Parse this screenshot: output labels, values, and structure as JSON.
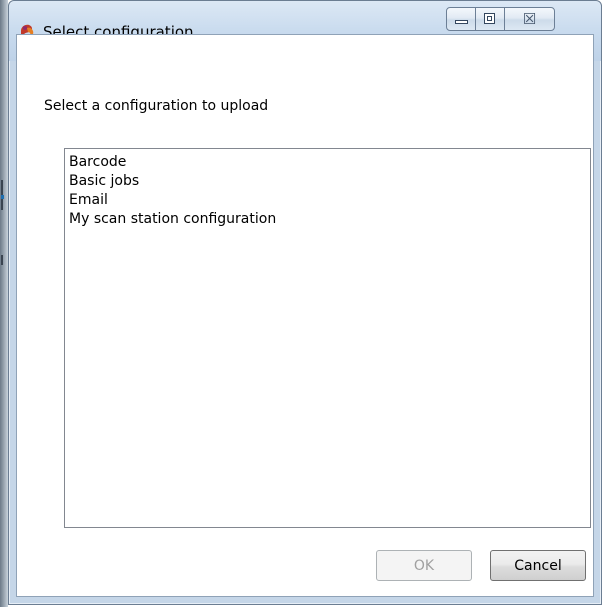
{
  "window": {
    "title": "Select configuration",
    "controls": {
      "minimize_icon": "minimize-icon",
      "maximize_icon": "maximize-icon",
      "close_glyph": "☒"
    }
  },
  "dialog": {
    "prompt": "Select a configuration to upload",
    "configurations": [
      "Barcode",
      "Basic jobs",
      "Email",
      "My scan station configuration"
    ]
  },
  "buttons": {
    "ok_label": "OK",
    "ok_enabled": false,
    "cancel_label": "Cancel"
  },
  "colors": {
    "titlebar": "#c9dbee",
    "window_border": "#6b7d92",
    "disabled_text": "#a0a0a0"
  }
}
